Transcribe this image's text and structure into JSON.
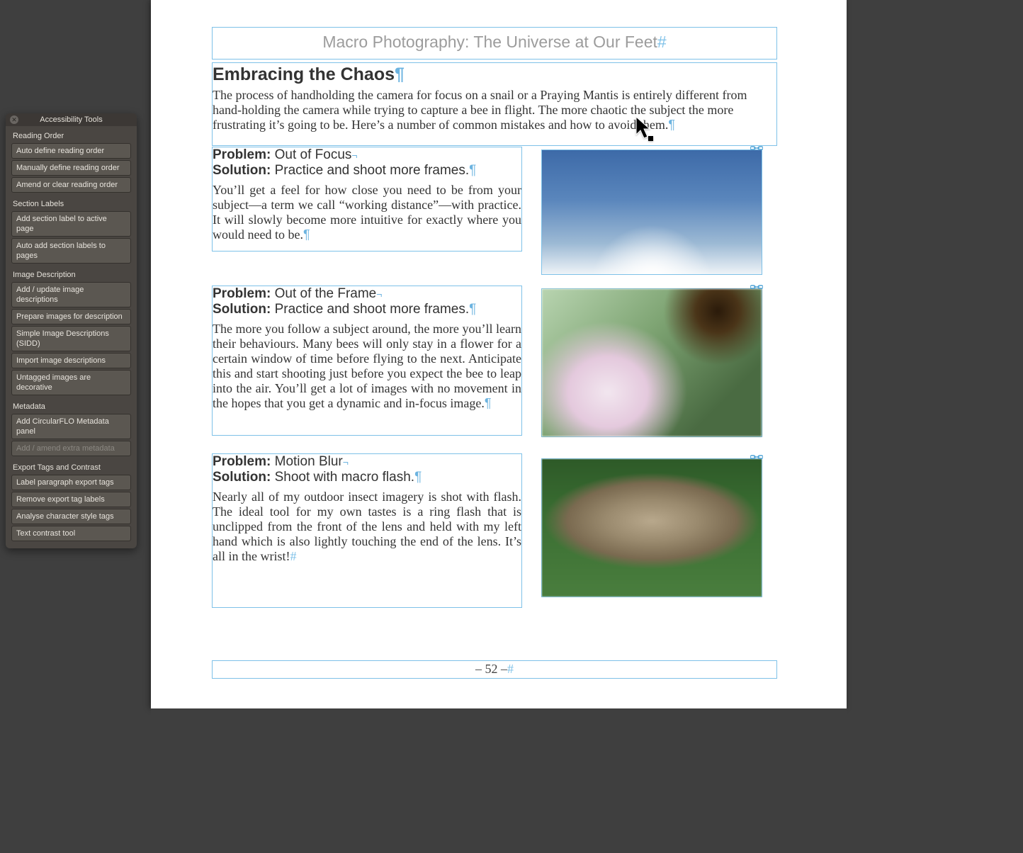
{
  "panel": {
    "title": "Accessibility Tools",
    "sections": {
      "reading_order": {
        "heading": "Reading Order",
        "items": [
          "Auto define reading order",
          "Manually define reading order",
          "Amend or clear reading order"
        ]
      },
      "section_labels": {
        "heading": "Section Labels",
        "items": [
          "Add section label to active page",
          "Auto add section labels to pages"
        ]
      },
      "image_description": {
        "heading": "Image Description",
        "items": [
          "Add / update image descriptions",
          "Prepare images for description",
          "Simple Image Descriptions (SIDD)",
          "Import image descriptions",
          "Untagged images are decorative"
        ]
      },
      "metadata": {
        "heading": "Metadata",
        "items": [
          "Add CircularFLO Metadata panel",
          "Add / amend extra metadata"
        ]
      },
      "export_tags": {
        "heading": "Export Tags and Contrast",
        "items": [
          "Label paragraph export tags",
          "Remove export tag labels",
          "Analyse character style tags",
          "Text contrast tool"
        ]
      }
    }
  },
  "doc": {
    "running_head": "Macro Photography: The Universe at Our Feet",
    "heading": "Embracing the Chaos",
    "intro": "The process of handholding the camera for focus on a snail or a Praying Mantis is entirely different from hand-holding the camera while trying to capture a bee in flight. The more chaotic the subject the more frustrating it’s going to be. Here’s a number of common mistakes and how to avoid them.",
    "blocks": [
      {
        "problem_label": "Problem:",
        "problem_text": " Out of Focus",
        "solution_label": "Solution:",
        "solution_text": " Practice and shoot more frames.",
        "body": "You’ll get a feel for how close you need to be from your subject—a term we call “working distance”—with practice. It will slowly become more intuitive for exactly where you would need to be."
      },
      {
        "problem_label": "Problem:",
        "problem_text": " Out of the Frame",
        "solution_label": "Solution:",
        "solution_text": " Practice and shoot more frames.",
        "body": "The more you follow a subject around, the more you’ll learn their behaviours. Many bees will only stay in a flower for a certain window of time before flying to the next. Anticipate this and start shooting just before you expect the bee to leap into the air. You’ll get a lot of images with no movement in the hopes that you get a dynamic and in-focus image."
      },
      {
        "problem_label": "Problem:",
        "problem_text": " Motion Blur",
        "solution_label": "Solution:",
        "solution_text": " Shoot with macro flash.",
        "body": "Nearly all of my outdoor insect imagery is shot with flash. The ideal tool for my own tastes is a ring flash that is unclipped from the front of the lens and held with my left hand which is also lightly touching the end of the lens. It’s all in the wrist!"
      }
    ],
    "page_number": "– 52 –"
  }
}
